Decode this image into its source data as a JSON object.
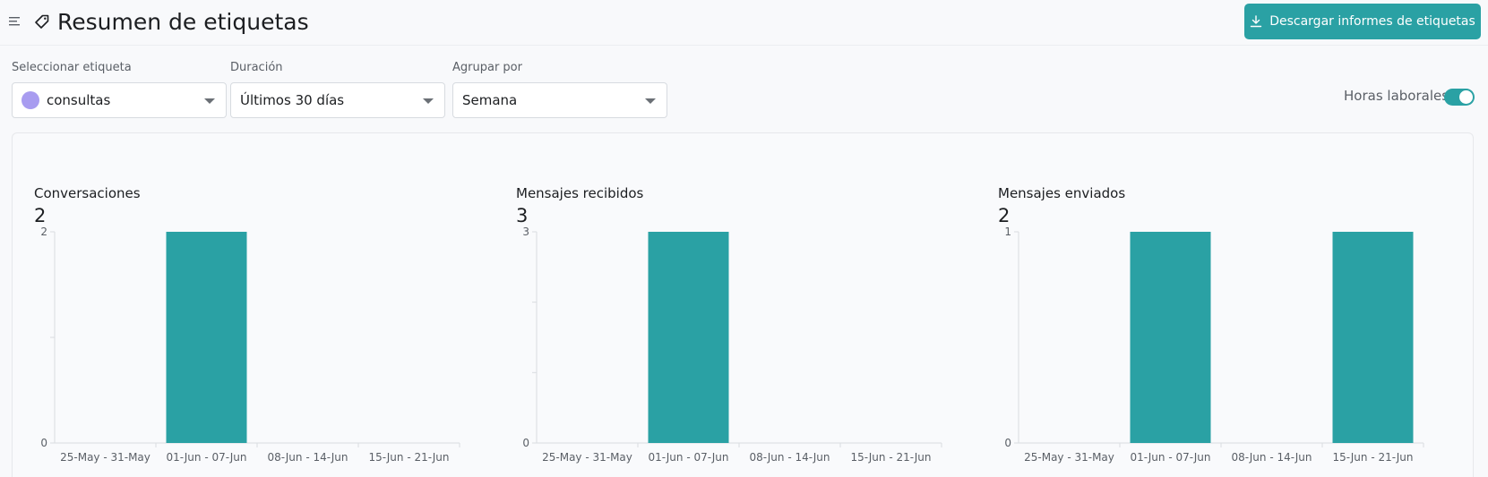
{
  "header": {
    "title": "Resumen de etiquetas",
    "download_label": "Descargar informes de etiquetas"
  },
  "filters": {
    "label": {
      "title": "Seleccionar etiqueta",
      "value": "consultas",
      "dot_color": "#a89cf0"
    },
    "duration": {
      "title": "Duración",
      "value": "Últimos 30 días"
    },
    "group_by": {
      "title": "Agrupar por",
      "value": "Semana"
    },
    "business_hours": {
      "label": "Horas laborales",
      "enabled": true
    }
  },
  "colors": {
    "accent": "#2aa1a4"
  },
  "metrics": [
    {
      "title": "Conversaciones",
      "value": "2"
    },
    {
      "title": "Mensajes recibidos",
      "value": "3"
    },
    {
      "title": "Mensajes enviados",
      "value": "2"
    }
  ],
  "chart_data": [
    {
      "type": "bar",
      "categories": [
        "25-May - 31-May",
        "01-Jun - 07-Jun",
        "08-Jun - 14-Jun",
        "15-Jun - 21-Jun"
      ],
      "values": [
        0,
        2,
        0,
        0
      ],
      "ylim": [
        0,
        2
      ],
      "yticks": [
        "0",
        "2"
      ],
      "minor_ticks": 1
    },
    {
      "type": "bar",
      "categories": [
        "25-May - 31-May",
        "01-Jun - 07-Jun",
        "08-Jun - 14-Jun",
        "15-Jun - 21-Jun"
      ],
      "values": [
        0,
        3,
        0,
        0
      ],
      "ylim": [
        0,
        3
      ],
      "yticks": [
        "0",
        "3"
      ],
      "minor_ticks": 2
    },
    {
      "type": "bar",
      "categories": [
        "25-May - 31-May",
        "01-Jun - 07-Jun",
        "08-Jun - 14-Jun",
        "15-Jun - 21-Jun"
      ],
      "values": [
        0,
        1,
        0,
        1
      ],
      "ylim": [
        0,
        1
      ],
      "yticks": [
        "0",
        "1"
      ],
      "minor_ticks": 0
    }
  ]
}
